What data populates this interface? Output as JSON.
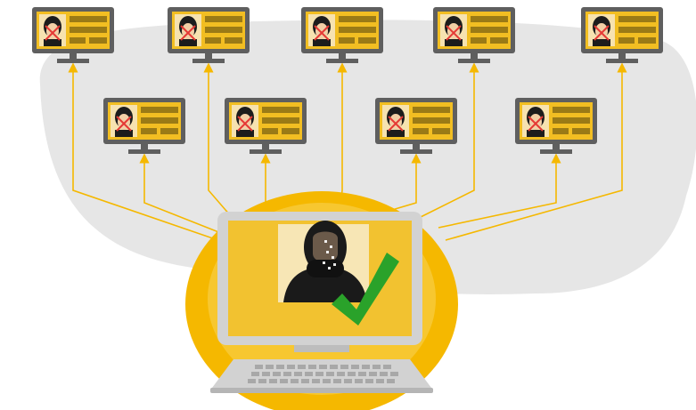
{
  "colors": {
    "accent": "#f5b800",
    "accent_dark": "#e0a300",
    "card": "#f2be22",
    "card_stripe": "#9a7a16",
    "blob": "#e6e6e6",
    "monitor": "#5f5f5f",
    "laptop_frame": "#d2d2d2",
    "laptop_screen": "#f2c230",
    "portrait_bg": "#f7e6b5",
    "check": "#2aa22a",
    "reject_mark": "#e53935"
  },
  "diagram": {
    "hub": {
      "icon": "laptop-icon",
      "face": "verified-face-icon",
      "status_icon": "checkmark-icon"
    },
    "remote_screens": [
      {
        "id": "top-1",
        "status_icon": "x-mark-icon"
      },
      {
        "id": "top-2",
        "status_icon": "x-mark-icon"
      },
      {
        "id": "top-3",
        "status_icon": "x-mark-icon"
      },
      {
        "id": "top-4",
        "status_icon": "x-mark-icon"
      },
      {
        "id": "top-5",
        "status_icon": "x-mark-icon"
      },
      {
        "id": "mid-1",
        "status_icon": "x-mark-icon"
      },
      {
        "id": "mid-2",
        "status_icon": "x-mark-icon"
      },
      {
        "id": "mid-3",
        "status_icon": "x-mark-icon"
      },
      {
        "id": "mid-4",
        "status_icon": "x-mark-icon"
      }
    ]
  }
}
